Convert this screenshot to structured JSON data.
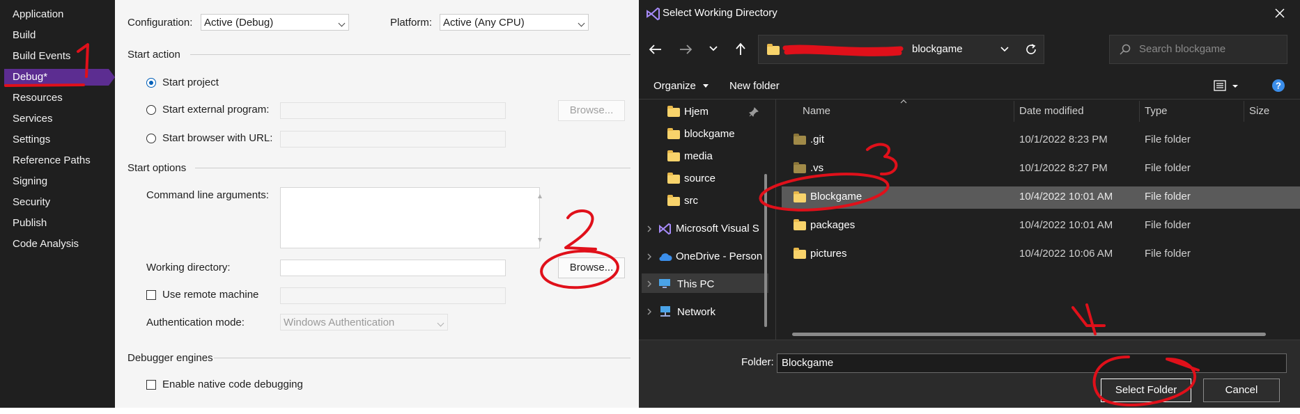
{
  "nav": {
    "items": [
      "Application",
      "Build",
      "Build Events",
      "Debug*",
      "Resources",
      "Services",
      "Settings",
      "Reference Paths",
      "Signing",
      "Security",
      "Publish",
      "Code Analysis"
    ],
    "active_index": 3
  },
  "props": {
    "configuration_label": "Configuration:",
    "configuration_value": "Active (Debug)",
    "platform_label": "Platform:",
    "platform_value": "Active (Any CPU)",
    "start_action": "Start action",
    "start_project": "Start project",
    "start_external": "Start external program:",
    "start_browser": "Start browser with URL:",
    "browse_label": "Browse...",
    "start_options": "Start options",
    "cmd_args": "Command line arguments:",
    "working_dir": "Working directory:",
    "use_remote": "Use remote machine",
    "auth_mode": "Authentication mode:",
    "auth_value": "Windows Authentication",
    "debugger_engines": "Debugger engines",
    "native_debug": "Enable native code debugging"
  },
  "dialog": {
    "title": "Select Working Directory",
    "address_current": "blockgame",
    "search_placeholder": "Search blockgame",
    "organize": "Organize",
    "new_folder": "New folder",
    "tree": [
      "Hjem",
      "blockgame",
      "media",
      "source",
      "src",
      "Microsoft Visual S",
      "OneDrive - Person",
      "This PC",
      "Network"
    ],
    "columns": [
      "Name",
      "Date modified",
      "Type",
      "Size"
    ],
    "rows": [
      {
        "name": ".git",
        "date": "10/1/2022 8:23 PM",
        "type": "File folder"
      },
      {
        "name": ".vs",
        "date": "10/1/2022 8:27 PM",
        "type": "File folder"
      },
      {
        "name": "Blockgame",
        "date": "10/4/2022 10:01 AM",
        "type": "File folder"
      },
      {
        "name": "packages",
        "date": "10/4/2022 10:01 AM",
        "type": "File folder"
      },
      {
        "name": "pictures",
        "date": "10/4/2022 10:06 AM",
        "type": "File folder"
      }
    ],
    "folder_label": "Folder:",
    "folder_value": "Blockgame",
    "select_button": "Select Folder",
    "cancel_button": "Cancel"
  },
  "annotations": [
    "1",
    "2",
    "3",
    "4"
  ],
  "colors": {
    "accent": "#5c2d91",
    "annotation": "#e0101a",
    "selected_row": "#5a5a5a",
    "radio_accent": "#005fb8"
  }
}
